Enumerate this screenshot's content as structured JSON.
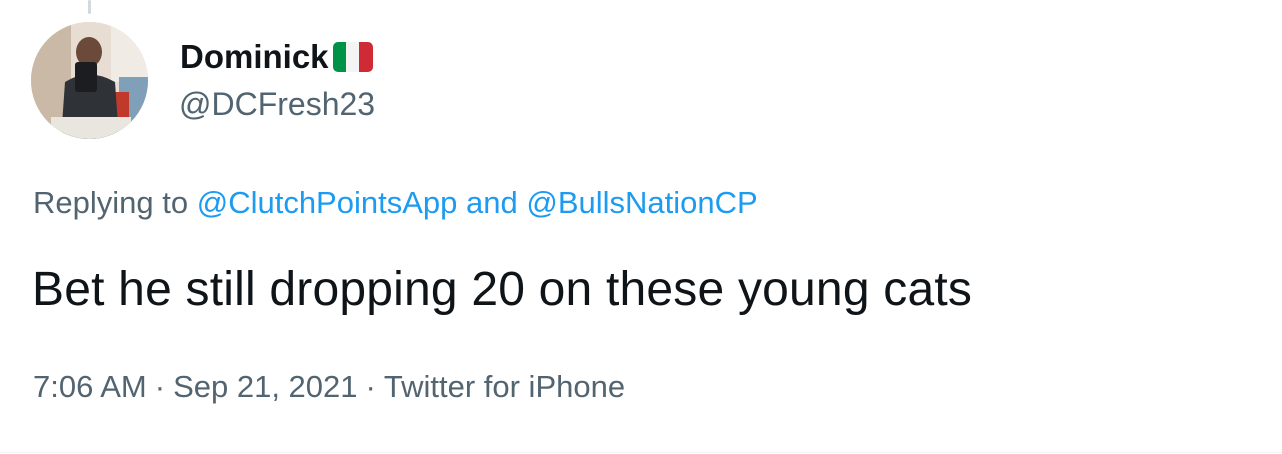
{
  "author": {
    "name": "Dominick",
    "flag": "italy-flag-emoji",
    "handle": "@DCFresh23",
    "avatar": "avatar-photo"
  },
  "reply": {
    "prefix": "Replying to",
    "mentions": [
      "@ClutchPointsApp",
      "@BullsNationCP"
    ],
    "conjunction": "and"
  },
  "tweet": {
    "text": "Bet he still dropping 20 on these young cats"
  },
  "meta": {
    "time": "7:06 AM",
    "separator": "·",
    "date": "Sep 21, 2021",
    "source": "Twitter for iPhone"
  },
  "colors": {
    "text": "#0f1419",
    "secondary": "#536471",
    "link": "#1d9bf0",
    "flag_green": "#009246",
    "flag_white": "#f4f4f4",
    "flag_red": "#ce2b37"
  }
}
